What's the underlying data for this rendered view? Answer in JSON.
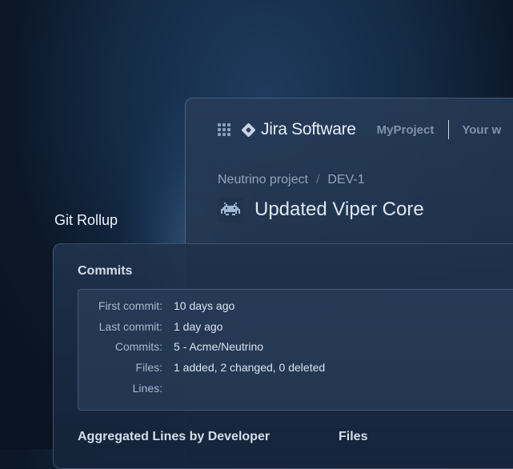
{
  "jira": {
    "app_name": "Jira Software",
    "project_nav": "MyProject",
    "your_work": "Your w",
    "breadcrumb": {
      "project": "Neutrino project",
      "separator": "/",
      "issue_key": "DEV-1"
    },
    "issue_title": "Updated Viper Core",
    "icons": {
      "app_switcher": "grid-icon",
      "logo": "jira-diamond-icon",
      "issue_type": "space-invader-icon"
    }
  },
  "git_rollup": {
    "title": "Git Rollup",
    "commits_heading": "Commits",
    "details": [
      {
        "label": "First commit:",
        "value": "10 days ago"
      },
      {
        "label": "Last commit:",
        "value": "1 day ago"
      },
      {
        "label": "Commits:",
        "value": "5 - Acme/Neutrino"
      },
      {
        "label": "Files:",
        "value": "1 added, 2 changed, 0 deleted"
      },
      {
        "label": "Lines:",
        "value": ""
      }
    ],
    "aggregated_heading": "Aggregated Lines by Developer",
    "files_heading": "Files"
  },
  "colors": {
    "background": "#0c1829",
    "card": "#1f324c",
    "accent_text": "#7f93ad"
  }
}
